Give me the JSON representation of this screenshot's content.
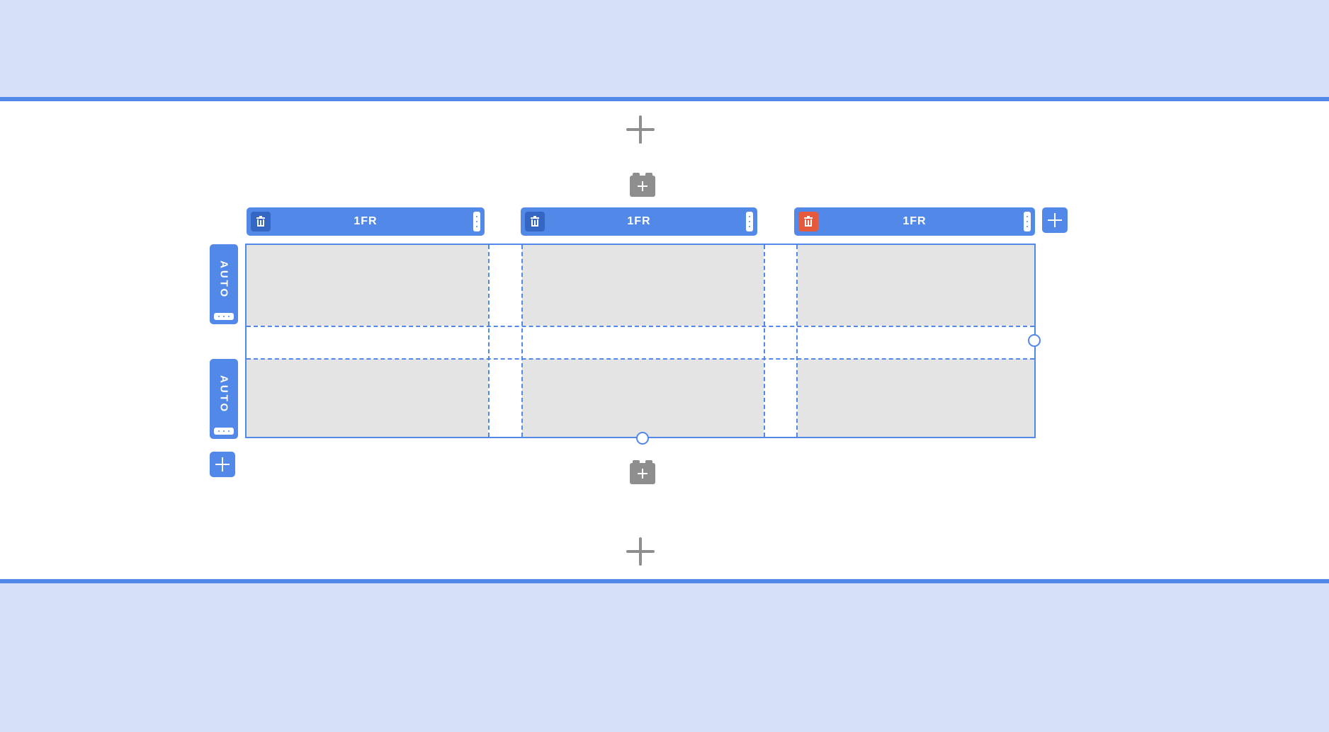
{
  "toolbar": {
    "add_section_top_icon": "plus-icon",
    "add_block_icon": "block-plus-icon"
  },
  "grid": {
    "columns": [
      {
        "label": "1FR",
        "delete_active": false
      },
      {
        "label": "1FR",
        "delete_active": false
      },
      {
        "label": "1FR",
        "delete_active": true
      }
    ],
    "rows": [
      {
        "label": "AUTO"
      },
      {
        "label": "AUTO"
      }
    ]
  },
  "colors": {
    "accent": "#5289e9",
    "page_background": "#d4e1f9",
    "cell_fill": "#e4e4e4",
    "danger": "#e55a3c",
    "icon_gray": "#8e8e8e"
  }
}
